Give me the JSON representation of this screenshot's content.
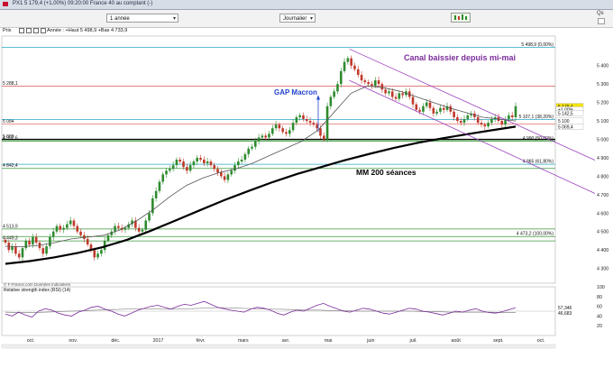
{
  "window": {
    "title": "PX1  5 179,4 (+1,00%)  09:20:00 France 40 au comptant (-)"
  },
  "toolbar": {
    "period_value": "1 année",
    "interval_value": "Journalier",
    "corner_qs": "Qs"
  },
  "info": {
    "prix_label": "Prix",
    "annee_text": "Année : +Haut 5 498,9 +Bas 4 733,9"
  },
  "annotations": {
    "gap": "GAP Macron",
    "canal": "Canal baissier depuis mi-mai",
    "mm200": "MM 200 séances"
  },
  "source_text": "© F-France.com Données indicatives",
  "colors": {
    "background": "#ffffff",
    "candle_up": "#2e8b2e",
    "candle_down": "#c0392b",
    "mm200": "#000000",
    "mm50": "#555555",
    "channel": "#9b3fbf",
    "red_levels": "#d9534f",
    "green_levels": "#3a9a3a",
    "cyan_levels": "#29a9c9",
    "rsi_line": "#7b2d9b",
    "rsi_ma": "#888888"
  },
  "chart_data": [
    {
      "type": "line",
      "title": "",
      "subtitle": "",
      "xlabel": "",
      "ylabel": "",
      "ylim": [
        4220,
        5560
      ],
      "y_ticks": [
        4300,
        4400,
        4500,
        4600,
        4700,
        4800,
        4900,
        5000,
        5100,
        5200,
        5300,
        5400
      ],
      "y_tick_labels": [
        "4 300",
        "4 400",
        "4 500",
        "4 600",
        "4 700",
        "4 800",
        "4 900",
        "5 000",
        "5 100",
        "5 200",
        "5 300",
        "5 400"
      ],
      "x_labels": [
        "oct.",
        "nov.",
        "déc.",
        "2017",
        "févr.",
        "mars",
        "avr.",
        "mai",
        "juin",
        "juil.",
        "août",
        "sept.",
        "oct."
      ],
      "grid": false,
      "horizontal_levels": [
        {
          "value": 5498.9,
          "label": "5 498,9 (0,00%)",
          "side": "right",
          "color": "#29a9c9"
        },
        {
          "value": 5288.1,
          "label": "5 288,1",
          "side": "left",
          "color": "#d9534f"
        },
        {
          "value": 5084,
          "label": "5 084",
          "side": "left",
          "color": "#d9534f"
        },
        {
          "value": 5107.1,
          "label": "5 107,1 (38,20%)",
          "side": "right",
          "color": "#29a9c9"
        },
        {
          "value": 5000,
          "label": "5 000",
          "side": "left",
          "color": "#000000"
        },
        {
          "value": 4992.6,
          "label": "4 992,6",
          "side": "left",
          "color": "#3a9a3a"
        },
        {
          "value": 4990,
          "label": "4 990 (50,00%)",
          "side": "right",
          "color": "#3a9a3a"
        },
        {
          "value": 4865,
          "label": "4 865 (61,80%)",
          "side": "right",
          "color": "#29a9c9"
        },
        {
          "value": 4842.4,
          "label": "4 842,4",
          "side": "left",
          "color": "#3a9a3a"
        },
        {
          "value": 4513.9,
          "label": "4 513,9",
          "side": "left",
          "color": "#3a9a3a"
        },
        {
          "value": 4473.2,
          "label": "4 473,2 (100,00%)",
          "side": "right",
          "color": "#3a9a3a"
        },
        {
          "value": 4449.3,
          "label": "4 449,3",
          "side": "left",
          "color": "#3a9a3a"
        }
      ],
      "price_badges": [
        {
          "value": 5179.4,
          "label": "5 179,4",
          "bg": "#f5e400"
        },
        {
          "value": 5161,
          "label": "+1,00%",
          "bg": "#ffffff"
        },
        {
          "value": 5142.5,
          "label": "5 142,5",
          "bg": "#ffffff"
        },
        {
          "value": 5100,
          "label": "5 100",
          "bg": "#ffffff"
        },
        {
          "value": 5069.4,
          "label": "5 069,4",
          "bg": "#ffffff"
        }
      ],
      "series": [
        {
          "name": "",
          "kind": "candles",
          "close": [
            4440,
            4400,
            4420,
            4380,
            4360,
            4410,
            4450,
            4430,
            4470,
            4440,
            4410,
            4380,
            4420,
            4470,
            4500,
            4530,
            4510,
            4520,
            4540,
            4560,
            4530,
            4500,
            4480,
            4460,
            4430,
            4400,
            4360,
            4380,
            4400,
            4450,
            4480,
            4500,
            4530,
            4520,
            4510,
            4520,
            4540,
            4560,
            4520,
            4500,
            4510,
            4560,
            4600,
            4680,
            4720,
            4770,
            4810,
            4830,
            4840,
            4860,
            4890,
            4880,
            4850,
            4830,
            4860,
            4880,
            4900,
            4890,
            4870,
            4880,
            4860,
            4840,
            4820,
            4800,
            4780,
            4810,
            4830,
            4860,
            4880,
            4890,
            4920,
            4950,
            4960,
            4990,
            5010,
            5020,
            5010,
            5030,
            5060,
            5080,
            5060,
            5040,
            5030,
            5050,
            5090,
            5120,
            5130,
            5110,
            5100,
            5090,
            5080,
            5060,
            5020,
            5000,
            5180,
            5230,
            5260,
            5300,
            5370,
            5420,
            5440,
            5400,
            5380,
            5350,
            5320,
            5310,
            5300,
            5290,
            5320,
            5300,
            5270,
            5250,
            5260,
            5230,
            5220,
            5250,
            5240,
            5260,
            5230,
            5190,
            5160,
            5150,
            5180,
            5200,
            5170,
            5140,
            5150,
            5170,
            5160,
            5180,
            5150,
            5120,
            5100,
            5090,
            5110,
            5130,
            5140,
            5120,
            5090,
            5080,
            5070,
            5090,
            5110,
            5120,
            5100,
            5080,
            5110,
            5130,
            5120,
            5180
          ]
        },
        {
          "name": "",
          "kind": "line",
          "role": "mm200",
          "values": [
            4325,
            4340,
            4360,
            4385,
            4415,
            4455,
            4505,
            4560,
            4615,
            4670,
            4720,
            4768,
            4812,
            4850,
            4888,
            4922,
            4954,
            4982,
            5006,
            5028,
            5049,
            5069
          ]
        },
        {
          "name": "",
          "kind": "line",
          "role": "mm50",
          "values": [
            4420,
            4418,
            4425,
            4440,
            4460,
            4470,
            4480,
            4510,
            4560,
            4620,
            4690,
            4750,
            4790,
            4820,
            4840,
            4870,
            4910,
            4950,
            4990,
            5050,
            5150,
            5250,
            5290,
            5280,
            5260,
            5230,
            5200,
            5170,
            5145,
            5120,
            5110,
            5100
          ]
        }
      ],
      "channel": {
        "upper": [
          [
            0.628,
            5490
          ],
          [
            0.845,
            5195
          ]
        ],
        "lower": [
          [
            0.628,
            5320
          ],
          [
            0.845,
            5020
          ]
        ]
      }
    },
    {
      "type": "line",
      "title": "Relative strength index (RSI) (14)",
      "ylim": [
        0,
        100
      ],
      "y_ticks": [
        0,
        20,
        40,
        60,
        80,
        100
      ],
      "y_tick_labels": [
        "0",
        "20",
        "40",
        "60",
        "80",
        "100"
      ],
      "value_labels": [
        "57,346",
        "46,683"
      ],
      "series": [
        {
          "name": "",
          "kind": "rsi",
          "values": [
            44,
            40,
            48,
            42,
            38,
            50,
            55,
            52,
            46,
            42,
            40,
            48,
            52,
            58,
            60,
            54,
            50,
            44,
            40,
            46,
            52,
            56,
            60,
            62,
            58,
            54,
            60,
            64,
            62,
            66,
            70,
            64,
            58,
            55,
            52,
            50,
            48,
            54,
            58,
            56,
            52,
            46,
            42,
            48,
            52,
            50,
            56,
            62,
            66,
            60,
            55,
            50,
            48,
            52,
            56,
            54,
            50,
            46,
            44,
            48,
            52,
            56,
            54,
            50,
            48,
            45,
            42,
            46,
            50,
            48,
            52,
            55,
            50,
            47,
            46,
            49,
            53,
            57
          ]
        },
        {
          "name": "",
          "kind": "ma",
          "values": [
            48,
            47,
            47,
            48,
            49,
            50,
            51,
            52,
            53,
            54,
            55,
            55,
            54,
            54,
            55,
            56,
            57,
            57,
            56,
            55,
            54,
            54,
            53,
            52,
            52,
            51,
            51,
            50,
            50,
            50,
            50,
            50,
            49,
            49,
            48,
            48,
            48,
            48,
            47,
            47
          ]
        }
      ]
    }
  ]
}
